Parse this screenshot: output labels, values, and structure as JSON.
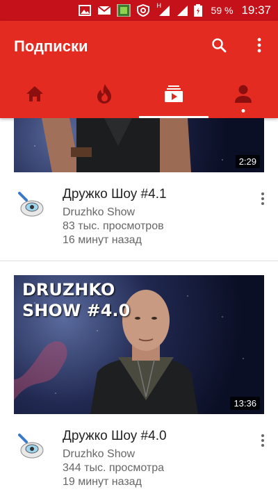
{
  "status_bar": {
    "battery_percent": "59 %",
    "time": "19:37",
    "network_label": "H"
  },
  "app_bar": {
    "title": "Подписки",
    "accent_color": "#e32b22",
    "tabs": [
      {
        "icon": "home-icon",
        "active": false
      },
      {
        "icon": "trending-icon",
        "active": false
      },
      {
        "icon": "subscriptions-icon",
        "active": true
      },
      {
        "icon": "account-icon",
        "active": false,
        "has_dot": true
      }
    ]
  },
  "videos": [
    {
      "duration": "2:29",
      "title": "Дружко Шоу #4.1",
      "channel": "Druzhko Show",
      "views": "83 тыс. просмотров",
      "time": "16 минут назад"
    },
    {
      "duration": "13:36",
      "title": "Дружко Шоу #4.0",
      "thumb_title_line1": "DRUZHKO",
      "thumb_title_line2": "SHOW #4.0",
      "channel": "Druzhko Show",
      "views": "344 тыс. просмотра",
      "time": "19 минут назад"
    }
  ]
}
